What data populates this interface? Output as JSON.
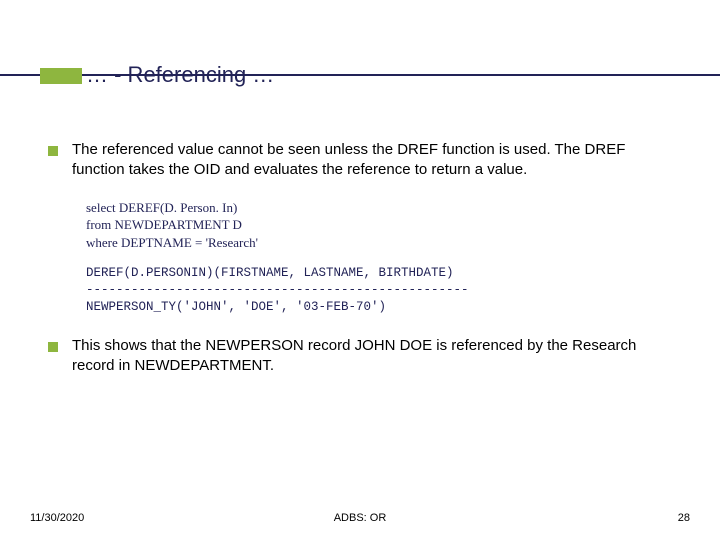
{
  "title": "… - Referencing …",
  "bullets": [
    "The referenced value cannot be seen unless the DREF function is used. The DREF function takes the OID and evaluates the reference to return a value.",
    "This shows that the NEWPERSON record JOHN DOE is referenced by the Research record in NEWDEPARTMENT."
  ],
  "code": "select DEREF(D. Person. In)\nfrom NEWDEPARTMENT D\nwhere DEPTNAME = 'Research'",
  "output": "DEREF(D.PERSONIN)(FIRSTNAME, LASTNAME, BIRTHDATE)\n---------------------------------------------------\nNEWPERSON_TY('JOHN', 'DOE', '03-FEB-70')",
  "footer": {
    "left": "11/30/2020",
    "center": "ADBS: OR",
    "right": "28"
  }
}
